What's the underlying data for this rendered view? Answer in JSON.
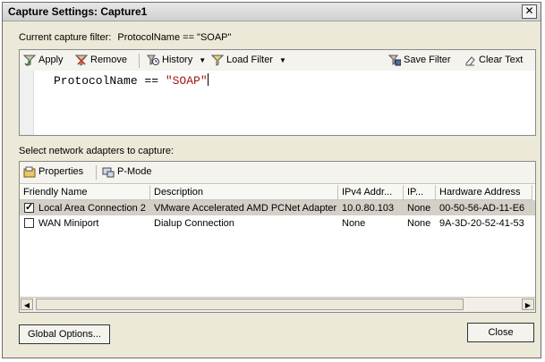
{
  "window": {
    "title": "Capture Settings: Capture1",
    "close_glyph": "✕"
  },
  "filter": {
    "label": "Current capture filter:",
    "current": "ProtocolName == \"SOAP\"",
    "toolbar": {
      "apply": "Apply",
      "remove": "Remove",
      "history": "History",
      "load_filter": "Load Filter",
      "save_filter": "Save Filter",
      "clear_text": "Clear Text"
    },
    "editor_text_prefix": "ProtocolName == ",
    "editor_text_string": "\"SOAP\""
  },
  "adapters": {
    "label": "Select network adapters to capture:",
    "toolbar": {
      "properties": "Properties",
      "pmode": "P-Mode"
    },
    "columns": [
      "Friendly Name",
      "Description",
      "IPv4 Addr...",
      "IP...",
      "Hardware Address"
    ],
    "rows": [
      {
        "checked": true,
        "name": "Local Area Connection 2",
        "description": "VMware Accelerated AMD PCNet Adapter",
        "ipv4": "10.0.80.103",
        "ip": "None",
        "hw": "00-50-56-AD-11-E6"
      },
      {
        "checked": false,
        "name": "WAN Miniport",
        "description": "Dialup Connection",
        "ipv4": "None",
        "ip": "None",
        "hw": "9A-3D-20-52-41-53"
      }
    ]
  },
  "buttons": {
    "global_options": "Global Options...",
    "close": "Close"
  }
}
